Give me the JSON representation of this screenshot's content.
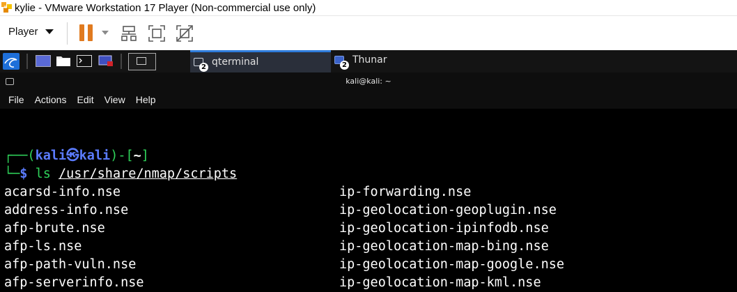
{
  "window": {
    "title": "kylie - VMware Workstation 17 Player (Non-commercial use only)"
  },
  "toolbar": {
    "player_label": "Player",
    "colors": {
      "pause": "#e07a1f"
    },
    "icons": [
      "pause-icon",
      "send-ctrl-alt-del-icon",
      "fullscreen-icon",
      "unity-icon"
    ]
  },
  "panel": {
    "tasks": [
      {
        "label": "qterminal",
        "badge": "2",
        "active": true
      },
      {
        "label": "Thunar",
        "badge": "2",
        "active": false
      }
    ],
    "colors": {
      "active_task_accent": "#2f7cdb"
    }
  },
  "terminal": {
    "title": "kali@kali: ~",
    "menu": [
      "File",
      "Actions",
      "Edit",
      "View",
      "Help"
    ],
    "prompt": {
      "open": "┌──(",
      "user": "kali",
      "at": "㉿",
      "host": "kali",
      "mid": ")-[",
      "cwd": "~",
      "close": "]",
      "line2_prefix": "└─",
      "dollar": "$",
      "command": "ls",
      "argument": "/usr/share/nmap/scripts"
    },
    "listing": {
      "col1": [
        "acarsd-info.nse",
        "address-info.nse",
        "afp-brute.nse",
        "afp-ls.nse",
        "afp-path-vuln.nse",
        "afp-serverinfo.nse"
      ],
      "col2": [
        "ip-forwarding.nse",
        "ip-geolocation-geoplugin.nse",
        "ip-geolocation-ipinfodb.nse",
        "ip-geolocation-map-bing.nse",
        "ip-geolocation-map-google.nse",
        "ip-geolocation-map-kml.nse"
      ]
    },
    "colors": {
      "prompt_frame": "#2fd35a",
      "prompt_user": "#5b7cff"
    }
  }
}
